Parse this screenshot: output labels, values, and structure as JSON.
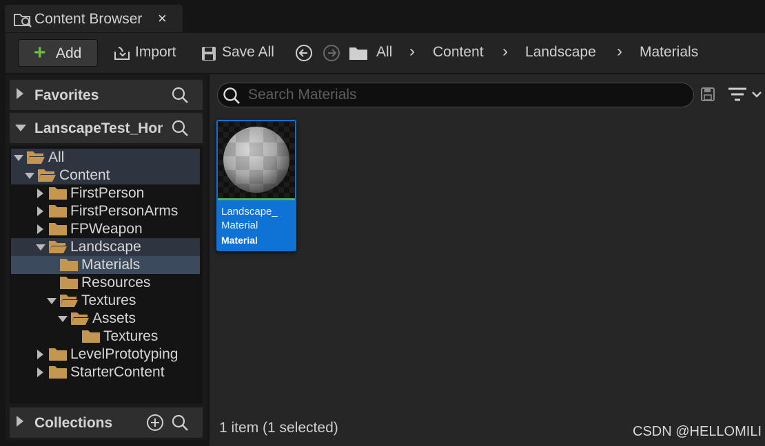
{
  "tab": {
    "title": "Content Browser",
    "close_glyph": "×",
    "icon": "content-browser-icon"
  },
  "toolbar": {
    "add_label": "Add",
    "import_label": "Import",
    "save_all_label": "Save All",
    "breadcrumbs": [
      "All",
      "Content",
      "Landscape",
      "Materials"
    ],
    "separator": "›"
  },
  "sidebar": {
    "favorites_title": "Favorites",
    "project_title": "LanscapeTest_Hon",
    "collections_title": "Collections",
    "tree": [
      {
        "label": "All",
        "depth": 0,
        "expanded": true,
        "open_folder": true,
        "state": "highlight"
      },
      {
        "label": "Content",
        "depth": 1,
        "expanded": true,
        "open_folder": true,
        "state": "highlight"
      },
      {
        "label": "FirstPerson",
        "depth": 2,
        "expanded": false,
        "open_folder": false,
        "state": ""
      },
      {
        "label": "FirstPersonArms",
        "depth": 2,
        "expanded": false,
        "open_folder": false,
        "state": ""
      },
      {
        "label": "FPWeapon",
        "depth": 2,
        "expanded": false,
        "open_folder": false,
        "state": ""
      },
      {
        "label": "Landscape",
        "depth": 2,
        "expanded": true,
        "open_folder": true,
        "state": "highlight"
      },
      {
        "label": "Materials",
        "depth": 3,
        "expanded": null,
        "open_folder": false,
        "state": "selected"
      },
      {
        "label": "Resources",
        "depth": 3,
        "expanded": null,
        "open_folder": false,
        "state": ""
      },
      {
        "label": "Textures",
        "depth": 3,
        "expanded": true,
        "open_folder": true,
        "state": ""
      },
      {
        "label": "Assets",
        "depth": 4,
        "expanded": true,
        "open_folder": true,
        "state": ""
      },
      {
        "label": "Textures",
        "depth": 5,
        "expanded": null,
        "open_folder": false,
        "state": ""
      },
      {
        "label": "LevelPrototyping",
        "depth": 2,
        "expanded": false,
        "open_folder": false,
        "state": ""
      },
      {
        "label": "StarterContent",
        "depth": 2,
        "expanded": false,
        "open_folder": false,
        "state": ""
      }
    ]
  },
  "main": {
    "search_placeholder": "Search Materials",
    "asset": {
      "name": "Landscape_ Material",
      "type": "Material"
    },
    "status": "1 item (1 selected)"
  },
  "watermark": "CSDN @HELLOMILI",
  "colors": {
    "accent": "#0f73d6",
    "add_plus": "#6abf3b",
    "folder": "#c4964f",
    "asset_bar": "#4cb84a"
  }
}
